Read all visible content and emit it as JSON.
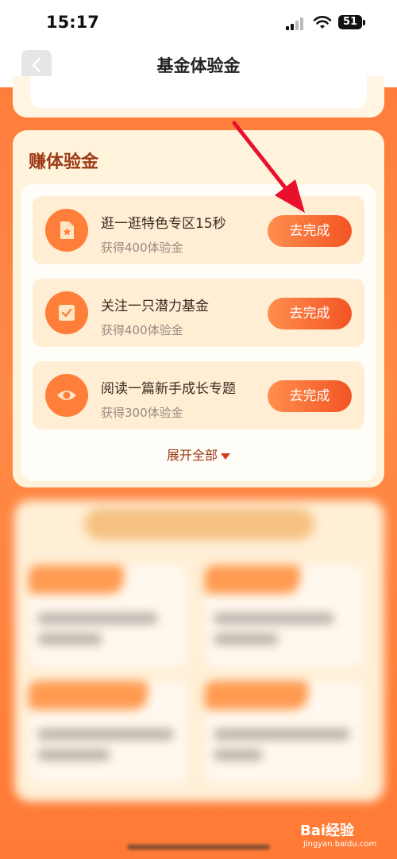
{
  "status_bar": {
    "time": "15:17",
    "battery": "51",
    "icons": [
      "signal-icon",
      "wifi-icon",
      "battery-icon"
    ]
  },
  "nav": {
    "title": "基金体验金",
    "back_icon": "chevron-left-icon"
  },
  "earn_section": {
    "title": "赚体验金",
    "tasks": [
      {
        "title": "逛一逛特色专区15秒",
        "reward": "获得400体验金",
        "button": "去完成",
        "icon": "document-star-icon"
      },
      {
        "title": "关注一只潜力基金",
        "reward": "获得400体验金",
        "button": "去完成",
        "icon": "checkbox-icon"
      },
      {
        "title": "阅读一篇新手成长专题",
        "reward": "获得300体验金",
        "button": "去完成",
        "icon": "eye-icon"
      }
    ],
    "expand_label": "展开全部",
    "expand_icon": "triangle-down-icon"
  },
  "watermark": {
    "brand": "Bai经验",
    "url": "jingyan.baidu.com"
  },
  "colors": {
    "accent": "#ff7a3a",
    "button_start": "#ff8f4e",
    "button_end": "#f25424",
    "section_title": "#9b3a14",
    "annotation_arrow": "#e8102a"
  }
}
